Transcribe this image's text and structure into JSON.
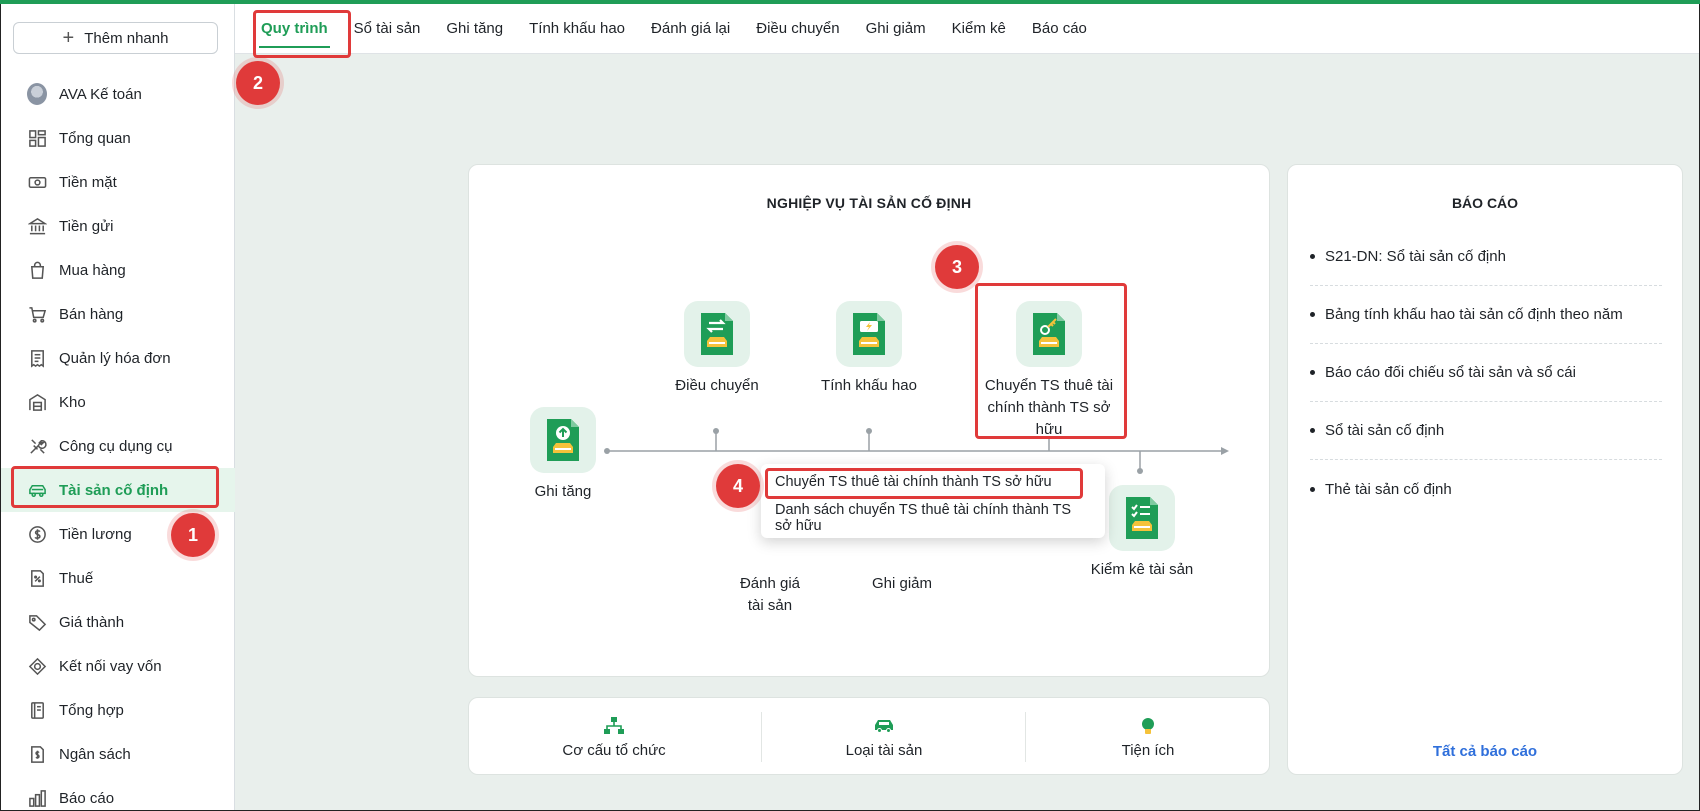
{
  "quick_add": {
    "label": "Thêm nhanh"
  },
  "sidebar": {
    "items": [
      {
        "label": "AVA Kế toán",
        "icon": "avatar-icon"
      },
      {
        "label": "Tổng quan",
        "icon": "dashboard-icon"
      },
      {
        "label": "Tiền mặt",
        "icon": "cash-icon"
      },
      {
        "label": "Tiền gửi",
        "icon": "bank-icon"
      },
      {
        "label": "Mua hàng",
        "icon": "shopping-bag-icon"
      },
      {
        "label": "Bán hàng",
        "icon": "cart-icon"
      },
      {
        "label": "Quản lý hóa đơn",
        "icon": "receipt-icon"
      },
      {
        "label": "Kho",
        "icon": "warehouse-icon"
      },
      {
        "label": "Công cụ dụng cụ",
        "icon": "tools-icon"
      },
      {
        "label": "Tài sản cố định",
        "icon": "car-icon",
        "active": true
      },
      {
        "label": "Tiền lương",
        "icon": "dollar-circle-icon"
      },
      {
        "label": "Thuế",
        "icon": "tax-icon"
      },
      {
        "label": "Giá thành",
        "icon": "tag-icon"
      },
      {
        "label": "Kết nối vay vốn",
        "icon": "link-icon"
      },
      {
        "label": "Tổng hợp",
        "icon": "ledger-icon"
      },
      {
        "label": "Ngân sách",
        "icon": "budget-icon"
      },
      {
        "label": "Báo cáo",
        "icon": "bar-chart-icon"
      }
    ]
  },
  "tabs": [
    {
      "label": "Quy trình",
      "active": true
    },
    {
      "label": "Sổ tài sản"
    },
    {
      "label": "Ghi tăng"
    },
    {
      "label": "Tính khấu hao"
    },
    {
      "label": "Đánh giá lại"
    },
    {
      "label": "Điều chuyển"
    },
    {
      "label": "Ghi giảm"
    },
    {
      "label": "Kiểm kê"
    },
    {
      "label": "Báo cáo"
    }
  ],
  "callouts": [
    "1",
    "2",
    "3",
    "4"
  ],
  "process": {
    "title": "NGHIỆP VỤ TÀI SẢN CỐ ĐỊNH",
    "nodes": {
      "ghi_tang": "Ghi tăng",
      "dieu_chuyen": "Điều chuyển",
      "tinh_khau_hao": "Tính khấu hao",
      "chuyen_ts_line1": "Chuyển TS thuê tài",
      "chuyen_ts_line2": "chính thành TS sở",
      "chuyen_ts_line3": "hữu",
      "danh_gia_line1": "Đánh giá",
      "danh_gia_line2": "tài sản",
      "ghi_giam": "Ghi giảm",
      "kiem_ke": "Kiểm kê tài sản"
    },
    "popup": [
      "Chuyển TS thuê tài chính thành TS sở hữu",
      "Danh sách chuyển TS thuê tài chính thành TS sở hữu"
    ]
  },
  "bottom": {
    "items": [
      {
        "label": "Cơ cấu tổ chức",
        "icon": "org-chart-icon"
      },
      {
        "label": "Loại tài sản",
        "icon": "car-icon"
      },
      {
        "label": "Tiện ích",
        "icon": "bulb-icon"
      }
    ]
  },
  "reports": {
    "title": "BÁO CÁO",
    "items": [
      "S21-DN: Sổ tài sản cố định",
      "Bảng tính khấu hao tài sản cố định theo năm",
      "Báo cáo đối chiếu sổ tài sản và sổ cái",
      "Sổ tài sản cố định",
      "Thẻ tài sản cố định"
    ],
    "all_link": "Tất cả báo cáo"
  },
  "colors": {
    "accent": "#1f9d57",
    "callout": "#e03a3a",
    "link": "#2f6fdb"
  }
}
